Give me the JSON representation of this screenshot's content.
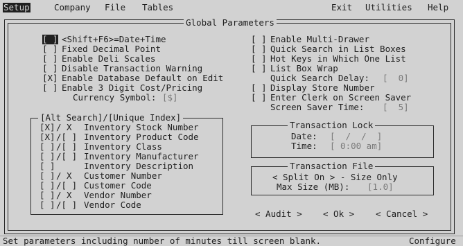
{
  "menu": {
    "setup": "Setup",
    "company": "Company",
    "file": "File",
    "tables": "Tables",
    "exit": "Exit",
    "utilities": "Utilities",
    "help": "Help"
  },
  "dialog": {
    "title": "Global Parameters",
    "left_options": [
      {
        "check": "[ ]",
        "label": "<Shift+F6>=Date+Time"
      },
      {
        "check": "[ ]",
        "label": "Fixed Decimal Point"
      },
      {
        "check": "[ ]",
        "label": "Enable Deli Scales"
      },
      {
        "check": "[ ]",
        "label": "Disable Transaction Warning"
      },
      {
        "check": "[X]",
        "label": "Enable Database Default on Edit"
      },
      {
        "check": "[ ]",
        "label": "Enable 3 Digit Cost/Pricing"
      }
    ],
    "currency_label": "Currency Symbol:",
    "currency_value": "[$]",
    "right_options": [
      {
        "check": "[ ]",
        "label": "Enable Multi-Drawer"
      },
      {
        "check": "[ ]",
        "label": "Quick Search in List Boxes"
      },
      {
        "check": "[ ]",
        "label": "Hot Keys in Which One List"
      },
      {
        "check": "[ ]",
        "label": "List Box Wrap"
      }
    ],
    "quick_search_delay_label": "Quick Search Delay:",
    "quick_search_delay_value": "[  0]",
    "right_options_2": [
      {
        "check": "[ ]",
        "label": "Display Store Number"
      },
      {
        "check": "[ ]",
        "label": "Enter Clerk on Screen Saver"
      }
    ],
    "screen_saver_time_label": "Screen Saver Time:",
    "screen_saver_time_value": "[  5]",
    "search_group": {
      "title": "[Alt Search]/[Unique Index]",
      "rows": [
        {
          "alt": "[X]",
          "uniq": "/ X ",
          "label": "Inventory Stock Number"
        },
        {
          "alt": "[X]",
          "uniq": "/[ ]",
          "label": "Inventory Product Code"
        },
        {
          "alt": "[ ]",
          "uniq": "/[ ]",
          "label": "Inventory Class"
        },
        {
          "alt": "[ ]",
          "uniq": "/[ ]",
          "label": "Inventory Manufacturer"
        },
        {
          "alt": "[ ]",
          "uniq": "    ",
          "label": "Inventory Description"
        },
        {
          "alt": "[ ]",
          "uniq": "/ X ",
          "label": "Customer Number"
        },
        {
          "alt": "[ ]",
          "uniq": "/[ ]",
          "label": "Customer Code"
        },
        {
          "alt": "[ ]",
          "uniq": "/ X ",
          "label": "Vendor Number"
        },
        {
          "alt": "[ ]",
          "uniq": "/[ ]",
          "label": "Vendor Code"
        }
      ]
    },
    "transaction_lock": {
      "title": "Transaction Lock",
      "date_label": "Date:",
      "date_value": "[  /  /  ]",
      "time_label": "Time:",
      "time_value": "[ 0:00 am]"
    },
    "transaction_file": {
      "title": "Transaction File",
      "split_line": "< Split On > - Size Only",
      "max_size_label": "Max Size (MB):",
      "max_size_value": "[1.0]"
    },
    "buttons": {
      "audit": "< Audit >",
      "ok": "< Ok >",
      "cancel": "< Cancel >"
    }
  },
  "status": {
    "message": "Set parameters including number of minutes till screen blank.",
    "right": "Configure"
  }
}
